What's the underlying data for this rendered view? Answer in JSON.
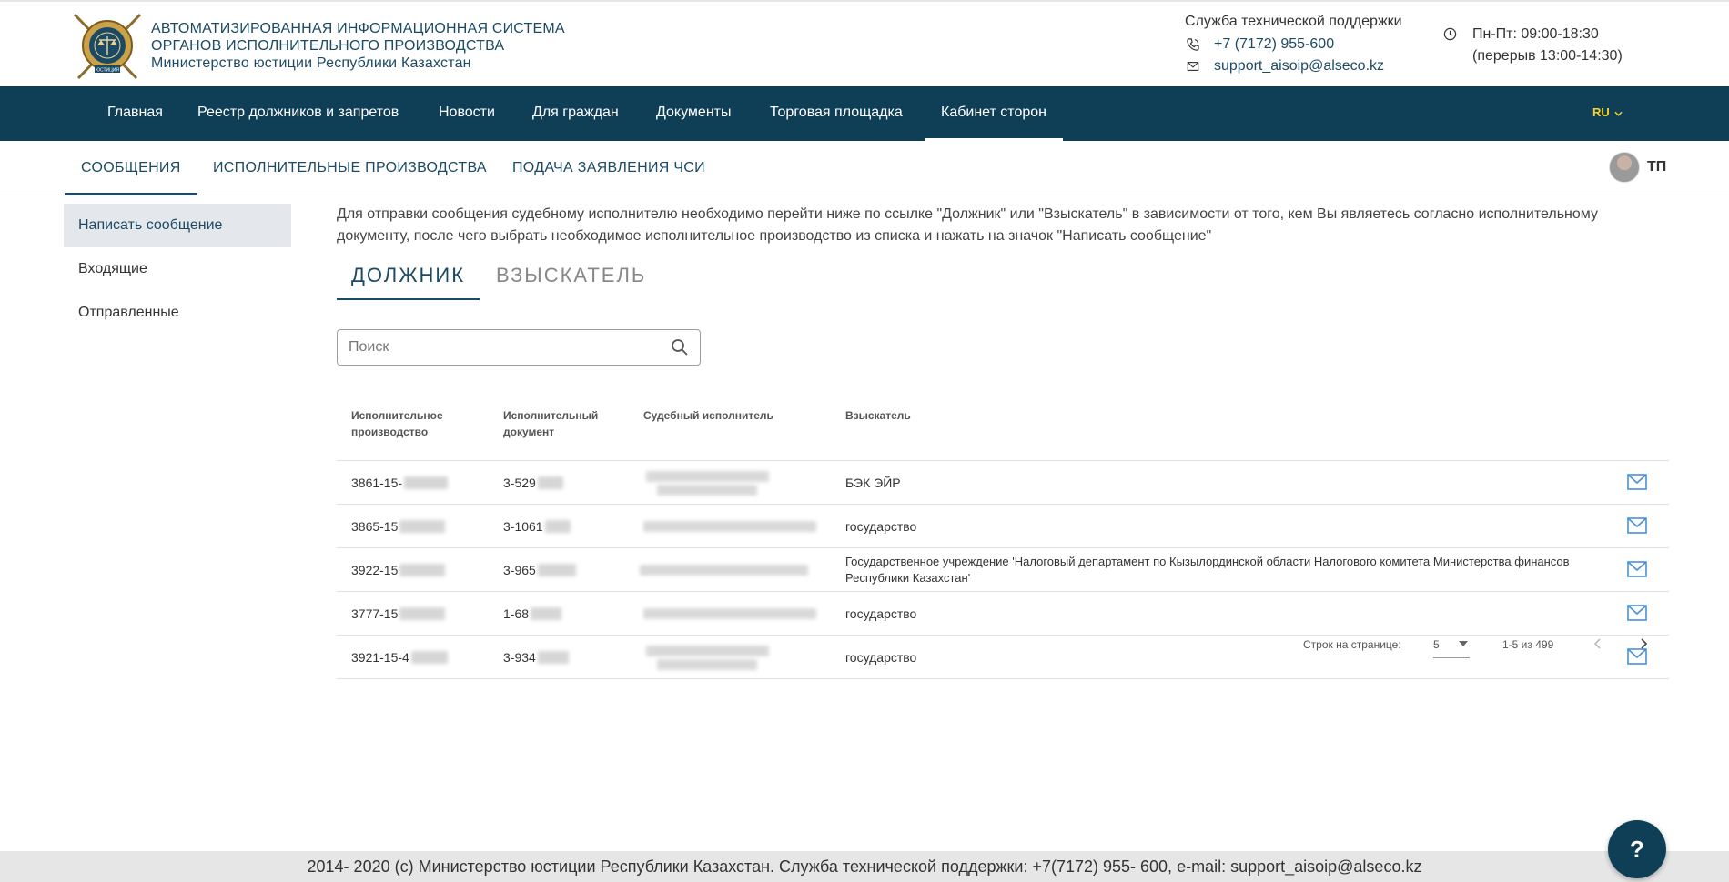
{
  "header": {
    "brand_line1": "АВТОМАТИЗИРОВАННАЯ ИНФОРМАЦИОННАЯ СИСТЕМА",
    "brand_line2": "ОРГАНОВ ИСПОЛНИТЕЛЬНОГО ПРОИЗВОДСТВА",
    "brand_line3": "Министерство юстиции Республики Казахстан",
    "logo_text": "ЮСТИЦИЯ",
    "support_title": "Служба технической поддержки",
    "support_phone": "+7 (7172) 955-600",
    "support_email": "support_aisoip@alseco.kz",
    "hours_line1": "Пн-Пт: 09:00-18:30",
    "hours_line2": "(перерыв 13:00-14:30)"
  },
  "nav": {
    "items": [
      {
        "label": "Главная"
      },
      {
        "label": "Реестр должников и запретов"
      },
      {
        "label": "Новости"
      },
      {
        "label": "Для граждан"
      },
      {
        "label": "Документы"
      },
      {
        "label": "Торговая площадка"
      },
      {
        "label": "Кабинет сторон"
      }
    ],
    "active_index": 6,
    "language": "RU"
  },
  "subtabs": {
    "items": [
      {
        "label": "СООБЩЕНИЯ"
      },
      {
        "label": "ИСПОЛНИТЕЛЬНЫЕ ПРОИЗВОДСТВА"
      },
      {
        "label": "ПОДАЧА ЗАЯВЛЕНИЯ ЧСИ"
      }
    ],
    "active_index": 0
  },
  "user": {
    "initials": "ТП"
  },
  "sidebar": {
    "items": [
      {
        "label": "Написать сообщение"
      },
      {
        "label": "Входящие"
      },
      {
        "label": "Отправленные"
      }
    ],
    "active_index": 0
  },
  "content": {
    "instruction": "Для отправки сообщения судебному исполнителю необходимо перейти ниже по ссылке \"Должник\" или \"Взыскатель\" в зависимости от того, кем Вы являетесь согласно исполнительному документу, после чего выбрать необходимое исполнительное производство из списка и нажать на значок \"Написать сообщение\"",
    "role_tabs": [
      {
        "label": "ДОЛЖНИК"
      },
      {
        "label": "ВЗЫСКАТЕЛЬ"
      }
    ],
    "active_role": 0,
    "search_placeholder": "Поиск"
  },
  "table": {
    "columns": [
      {
        "line1": "Исполнительное",
        "line2": "производство"
      },
      {
        "line1": "Исполнительный",
        "line2": "документ"
      },
      {
        "line1": "Судебный исполнитель",
        "line2": ""
      },
      {
        "line1": "Взыскатель",
        "line2": ""
      }
    ],
    "rows": [
      {
        "proceeding": "3861-15-",
        "document": "3-529",
        "claimant": "БЭК ЭЙР"
      },
      {
        "proceeding": "3865-15",
        "document": "3-1061",
        "claimant": "государство"
      },
      {
        "proceeding": "3922-15",
        "document": "3-965",
        "claimant": "Государственное учреждение 'Налоговый департамент по Кызылординской области Налогового комитета Министерства финансов Республики Казахстан'"
      },
      {
        "proceeding": "3777-15",
        "document": "1-68",
        "claimant": "государство"
      },
      {
        "proceeding": "3921-15-4",
        "document": "3-934",
        "claimant": "государство"
      }
    ]
  },
  "pager": {
    "rows_label": "Строк на странице:",
    "rows_value": "5",
    "range": "1-5 из 499"
  },
  "footer": {
    "text": "2014- 2020 (с) Министерство юстиции Республики Казахстан. Служба технической поддержки: +7(7172) 955- 600, e-mail: support_aisoip@alseco.kz"
  },
  "help": {
    "label": "?"
  },
  "colors": {
    "nav_bg": "#0f3f57",
    "brand_text": "#1c4a64",
    "lang_accent": "#f6d12a",
    "mail_icon": "#4a90d9"
  }
}
